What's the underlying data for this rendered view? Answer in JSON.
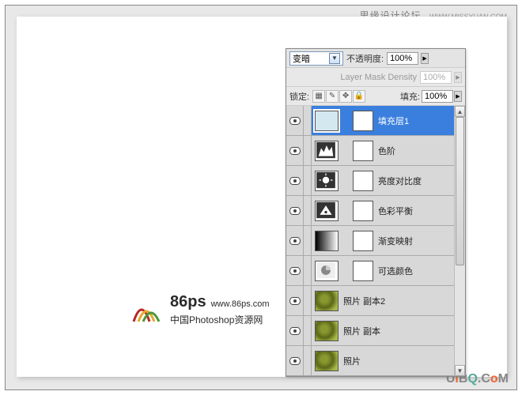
{
  "header": {
    "forum_text": "思缘设计论坛",
    "forum_url": "WWW.MISSYUAN.COM"
  },
  "watermark": {
    "brand": "86ps",
    "url": "www.86ps.com",
    "cn": "中国Photoshop资源网"
  },
  "bottom_watermark": "UiBQ.CoM",
  "panel": {
    "blend_mode": "变暗",
    "opacity_label": "不透明度:",
    "opacity_value": "100%",
    "mask_density_label": "Layer Mask Density",
    "mask_density_value": "100%",
    "lock_label": "锁定:",
    "fill_label": "填充:",
    "fill_value": "100%"
  },
  "layers": [
    {
      "name": "填充层1",
      "type": "fill",
      "selected": true
    },
    {
      "name": "色阶",
      "type": "levels"
    },
    {
      "name": "亮度对比度",
      "type": "brightness"
    },
    {
      "name": "色彩平衡",
      "type": "colorbalance"
    },
    {
      "name": "渐变映射",
      "type": "gradmap"
    },
    {
      "name": "可选颜色",
      "type": "selcolor"
    },
    {
      "name": "照片 副本2",
      "type": "image"
    },
    {
      "name": "照片 副本",
      "type": "image"
    },
    {
      "name": "照片",
      "type": "image"
    }
  ]
}
